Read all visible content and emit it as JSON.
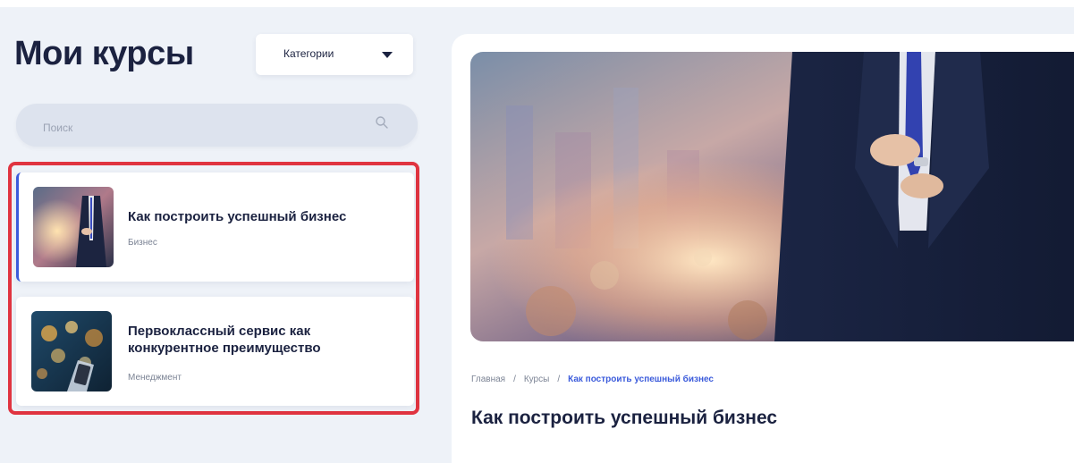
{
  "top_strip": {
    "text": ""
  },
  "sidebar": {
    "title": "Мои курсы",
    "category_button": {
      "label": "Категории",
      "icon": "caret-down-icon"
    },
    "search": {
      "placeholder": "Поиск",
      "value": "",
      "icon": "search-icon"
    },
    "courses": [
      {
        "title": "Как построить успешный бизнес",
        "category": "Бизнес",
        "selected": true
      },
      {
        "title": "Первоклассный сервис как конкурентное преимущество",
        "category": "Менеджмент",
        "selected": false
      }
    ]
  },
  "main": {
    "breadcrumb": [
      {
        "label": "Главная"
      },
      {
        "label": "Курсы"
      },
      {
        "label": "Как построить успешный бизнес",
        "current": true
      }
    ],
    "breadcrumb_separator": "/",
    "course_title": "Как построить успешный бизнес"
  },
  "colors": {
    "background": "#eef2f8",
    "accent": "#3b5bdb",
    "highlight": "#e03440",
    "text_dark": "#1b2240"
  }
}
